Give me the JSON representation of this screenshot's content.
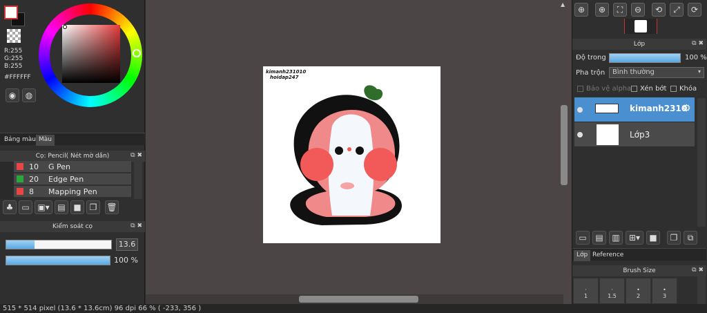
{
  "color": {
    "r": "R:255",
    "g": "G:255",
    "b": "B:255",
    "hex": "#FFFFFF",
    "fg_hex": "#ffffff",
    "accent": "#e53b3b"
  },
  "left_tabs": [
    "Bảng màu",
    "Màu"
  ],
  "brush_panel": {
    "title": "Cọ: Pencil( Nét mờ dần)",
    "items": [
      {
        "size": "10",
        "name": "G Pen",
        "color": "#e84545"
      },
      {
        "size": "20",
        "name": "Edge Pen",
        "color": "#2aa63a"
      },
      {
        "size": "8",
        "name": "Mapping Pen",
        "color": "#e84545"
      }
    ]
  },
  "brush_control": {
    "title": "Kiểm soát cọ",
    "size_value": "13.6",
    "size_fraction": 0.27,
    "opacity_value": "100 %",
    "opacity_fraction": 1.0
  },
  "canvas": {
    "watermark_line1": "kimanh231010",
    "watermark_line2": "hoidap247"
  },
  "layer_panel": {
    "title": "Lớp",
    "opacity_label": "Độ trong",
    "opacity_value": "100 %",
    "blend_label": "Pha trộn",
    "blend_value": "Bình thường",
    "lock_alpha": "Bảo vệ alpha",
    "clipping": "Xén bớt",
    "lock": "Khóa",
    "layers": [
      {
        "name": "kimanh2310",
        "selected": true
      },
      {
        "name": "Lớp3",
        "selected": false
      }
    ]
  },
  "right_tabs": [
    "Lớp",
    "Reference"
  ],
  "brush_size_panel": {
    "title": "Brush Size",
    "sizes": [
      "1",
      "1.5",
      "2",
      "3"
    ]
  },
  "status": {
    "text": "515 * 514 pixel   (13.6 * 13.6cm)   96 dpi   66 %   ( -233, 356 )"
  },
  "icons": {
    "gear": "gear-icon",
    "zoom": "zoom-icon"
  }
}
